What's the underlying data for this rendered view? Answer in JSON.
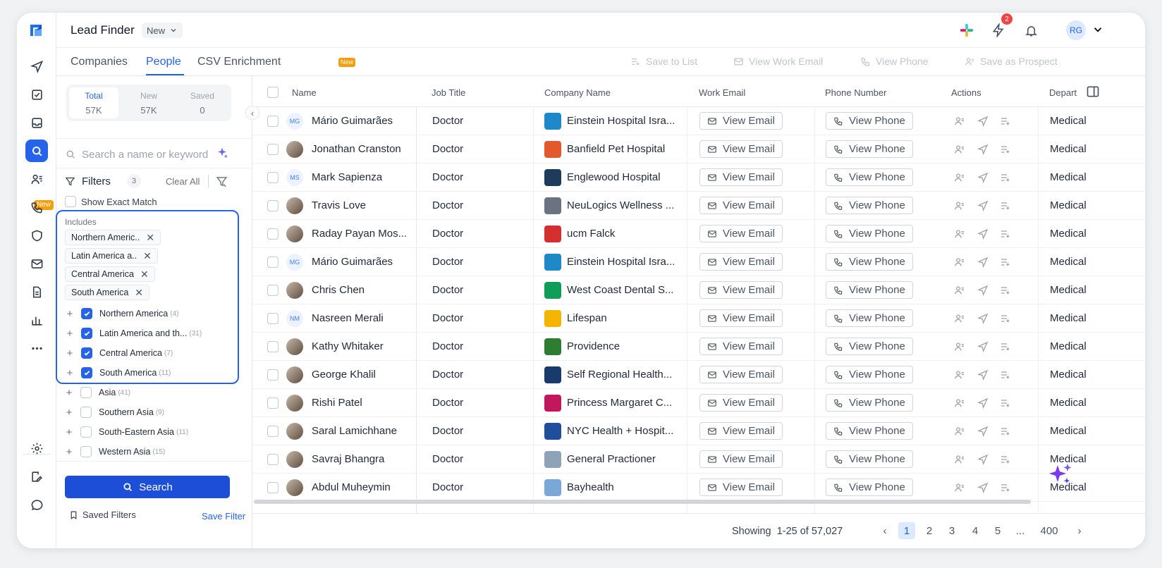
{
  "app": {
    "title": "Lead Finder",
    "view_chip": "New",
    "notification_count": "2",
    "user_initials": "RG"
  },
  "rail": {
    "new_badge": "New",
    "icons": [
      "logo-icon",
      "send-icon",
      "tasks-icon",
      "inbox-icon",
      "search-icon",
      "users-icon",
      "phone-icon",
      "shield-icon",
      "mail-icon",
      "document-icon",
      "analytics-icon",
      "more-icon",
      "settings-icon",
      "edit-icon",
      "chat-icon"
    ]
  },
  "tabs": [
    {
      "label": "Companies",
      "active": false
    },
    {
      "label": "People",
      "active": true
    },
    {
      "label": "CSV Enrichment",
      "active": false
    }
  ],
  "tabs_new_badge": "New",
  "toolbar": {
    "save_to_list": "Save to List",
    "view_work_email": "View Work Email",
    "view_phone": "View Phone",
    "save_as_prospect": "Save as Prospect"
  },
  "counts": [
    {
      "label": "Total",
      "value": "57K"
    },
    {
      "label": "New",
      "value": "57K"
    },
    {
      "label": "Saved",
      "value": "0"
    }
  ],
  "filter_panel": {
    "search_placeholder": "Search a name or keyword",
    "filters_label": "Filters",
    "filters_count": "3",
    "clear_all": "Clear All",
    "show_exact_match": "Show Exact Match",
    "includes_label": "Includes",
    "chips": [
      "Northern Americ..",
      "Latin America a..",
      "Central America",
      "South America"
    ],
    "tree": [
      {
        "label": "Northern America",
        "count": "(4)",
        "checked": true
      },
      {
        "label": "Latin America and th...",
        "count": "(31)",
        "checked": true
      },
      {
        "label": "Central America",
        "count": "(7)",
        "checked": true
      },
      {
        "label": "South America",
        "count": "(11)",
        "checked": true
      },
      {
        "label": "Asia",
        "count": "(41)",
        "checked": false
      },
      {
        "label": "Southern Asia",
        "count": "(9)",
        "checked": false
      },
      {
        "label": "South-Eastern Asia",
        "count": "(11)",
        "checked": false
      },
      {
        "label": "Western Asia",
        "count": "(15)",
        "checked": false
      }
    ],
    "search_button": "Search",
    "saved_filters": "Saved Filters",
    "save_filter": "Save Filter"
  },
  "table": {
    "columns": [
      "Name",
      "Job Title",
      "Company Name",
      "Work Email",
      "Phone Number",
      "Actions",
      "Depart"
    ],
    "view_email_label": "View Email",
    "view_phone_label": "View Phone",
    "rows": [
      {
        "avatar": "MG",
        "name": "Mário Guimarães",
        "job": "Doctor",
        "company": "Einstein Hospital Isra...",
        "logo_color": "#1e88c8",
        "dept": "Medical"
      },
      {
        "avatar": "",
        "name": "Jonathan Cranston",
        "job": "Doctor",
        "company": "Banfield Pet Hospital",
        "logo_color": "#e25a2c",
        "dept": "Medical"
      },
      {
        "avatar": "MS",
        "name": "Mark Sapienza",
        "job": "Doctor",
        "company": "Englewood Hospital",
        "logo_color": "#1f3b5c",
        "dept": "Medical"
      },
      {
        "avatar": "",
        "name": "Travis Love",
        "job": "Doctor",
        "company": "NeuLogics Wellness ...",
        "logo_color": "#6b7280",
        "dept": "Medical"
      },
      {
        "avatar": "",
        "name": "Raday Payan Mos...",
        "job": "Doctor",
        "company": "ucm Falck",
        "logo_color": "#d32f2f",
        "dept": "Medical"
      },
      {
        "avatar": "MG",
        "name": "Mário Guimarães",
        "job": "Doctor",
        "company": "Einstein Hospital Isra...",
        "logo_color": "#1e88c8",
        "dept": "Medical"
      },
      {
        "avatar": "",
        "name": "Chris Chen",
        "job": "Doctor",
        "company": "West Coast Dental S...",
        "logo_color": "#0f9d58",
        "dept": "Medical"
      },
      {
        "avatar": "NM",
        "name": "Nasreen Merali",
        "job": "Doctor",
        "company": "Lifespan",
        "logo_color": "#f4b400",
        "dept": "Medical"
      },
      {
        "avatar": "",
        "name": "Kathy Whitaker",
        "job": "Doctor",
        "company": "Providence",
        "logo_color": "#2e7d32",
        "dept": "Medical"
      },
      {
        "avatar": "",
        "name": "George Khalil",
        "job": "Doctor",
        "company": "Self Regional Health...",
        "logo_color": "#1a3a6b",
        "dept": "Medical"
      },
      {
        "avatar": "",
        "name": "Rishi Patel",
        "job": "Doctor",
        "company": "Princess Margaret C...",
        "logo_color": "#c2185b",
        "dept": "Medical"
      },
      {
        "avatar": "",
        "name": "Saral Lamichhane",
        "job": "Doctor",
        "company": "NYC Health + Hospit...",
        "logo_color": "#1f4e9c",
        "dept": "Medical"
      },
      {
        "avatar": "",
        "name": "Savraj Bhangra",
        "job": "Doctor",
        "company": "General Practioner",
        "logo_color": "#8fa3b8",
        "dept": "Medical"
      },
      {
        "avatar": "",
        "name": "Abdul Muheymin",
        "job": "Doctor",
        "company": "Bayhealth",
        "logo_color": "#7aa7d8",
        "dept": "Medical"
      }
    ]
  },
  "footer": {
    "showing_label": "Showing",
    "range": "1-25 of 57,027",
    "pages": [
      "1",
      "2",
      "3",
      "4",
      "5",
      "...",
      "400"
    ],
    "current_page": "1"
  },
  "colors": {
    "accent": "#2563eb",
    "badge_orange": "#f59e0b",
    "notification_red": "#ef4444"
  }
}
